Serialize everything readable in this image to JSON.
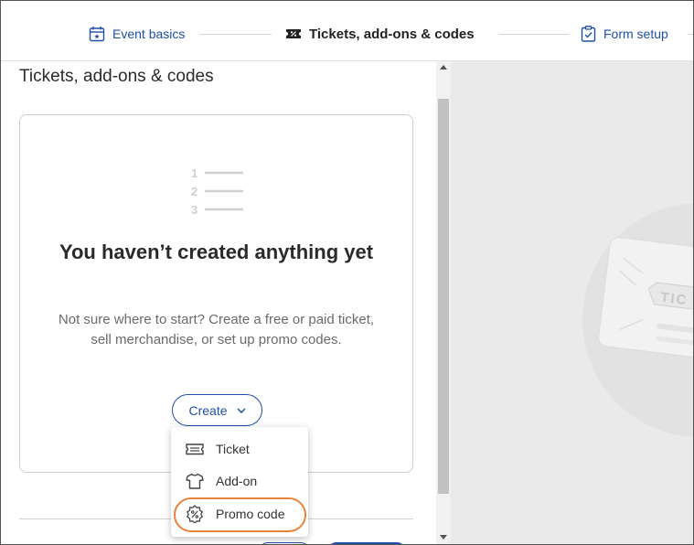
{
  "stepper": {
    "steps": [
      {
        "label": "Event basics",
        "icon": "calendar-icon"
      },
      {
        "label": "Tickets, add-ons & codes",
        "icon": "ticket-percent-icon"
      },
      {
        "label": "Form setup",
        "icon": "clipboard-check-icon"
      }
    ],
    "active_index": 1
  },
  "panel": {
    "title": "Tickets, add-ons & codes"
  },
  "empty_state": {
    "illustration": "numbered-list-icon",
    "list_numbers": [
      "1",
      "2",
      "3"
    ],
    "title": "You haven’t created anything yet",
    "body": "Not sure where to start? Create a free or paid ticket, sell merchandise, or set up promo codes."
  },
  "create_button": {
    "label": "Create",
    "icon": "chevron-down-icon"
  },
  "create_menu": {
    "items": [
      {
        "label": "Ticket",
        "icon": "ticket-icon"
      },
      {
        "label": "Add-on",
        "icon": "tshirt-icon"
      },
      {
        "label": "Promo code",
        "icon": "percent-badge-icon",
        "highlighted": true
      }
    ]
  },
  "preview": {
    "ticket_text": "TIC",
    "illustration": "ticket-illustration"
  },
  "colors": {
    "accent": "#1e4fa8",
    "highlight": "#e8833a",
    "preview_bg": "#eaeaea"
  }
}
